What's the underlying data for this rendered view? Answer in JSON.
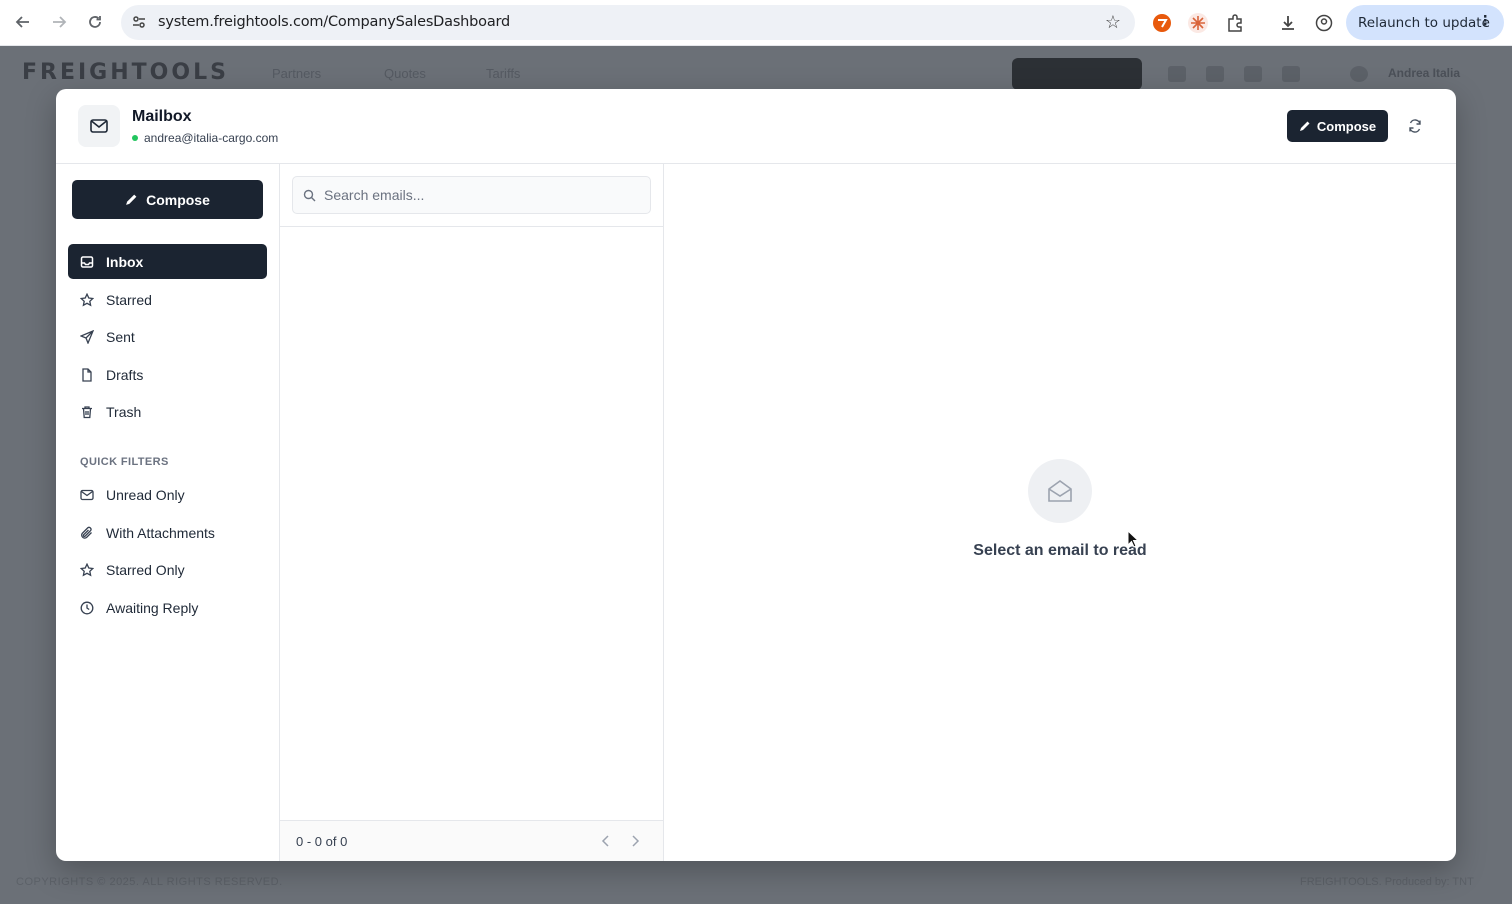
{
  "browser": {
    "url": "system.freightools.com/CompanySalesDashboard",
    "relaunch_label": "Relaunch to update"
  },
  "app_background": {
    "logo": "FREIGHTOOLS",
    "menu": [
      "Partners",
      "Quotes",
      "Tariffs"
    ],
    "user": "Andrea Italia",
    "footer_left": "COPYRIGHTS © 2025. ALL RIGHTS RESERVED.",
    "footer_right": "FREIGHTOOLS. Produced by: TNT"
  },
  "modal": {
    "title": "Mailbox",
    "account_email": "andrea@italia-cargo.com",
    "header_compose_label": "Compose"
  },
  "sidebar": {
    "compose_label": "Compose",
    "folders": [
      {
        "label": "Inbox",
        "icon": "inbox-icon",
        "active": true
      },
      {
        "label": "Starred",
        "icon": "star-icon",
        "active": false
      },
      {
        "label": "Sent",
        "icon": "send-icon",
        "active": false
      },
      {
        "label": "Drafts",
        "icon": "file-icon",
        "active": false
      },
      {
        "label": "Trash",
        "icon": "trash-icon",
        "active": false
      }
    ],
    "quick_filters_title": "QUICK FILTERS",
    "quick_filters": [
      {
        "label": "Unread Only",
        "icon": "envelope-icon"
      },
      {
        "label": "With Attachments",
        "icon": "paperclip-icon"
      },
      {
        "label": "Starred Only",
        "icon": "star-icon"
      },
      {
        "label": "Awaiting Reply",
        "icon": "clock-icon"
      }
    ]
  },
  "list": {
    "search_placeholder": "Search emails...",
    "pagination_text": "0 - 0 of 0"
  },
  "reader": {
    "empty_message": "Select an email to read"
  },
  "colors": {
    "primary_dark": "#1b2431",
    "online_dot": "#22c55e",
    "relaunch_bg": "#d3e3fd"
  }
}
